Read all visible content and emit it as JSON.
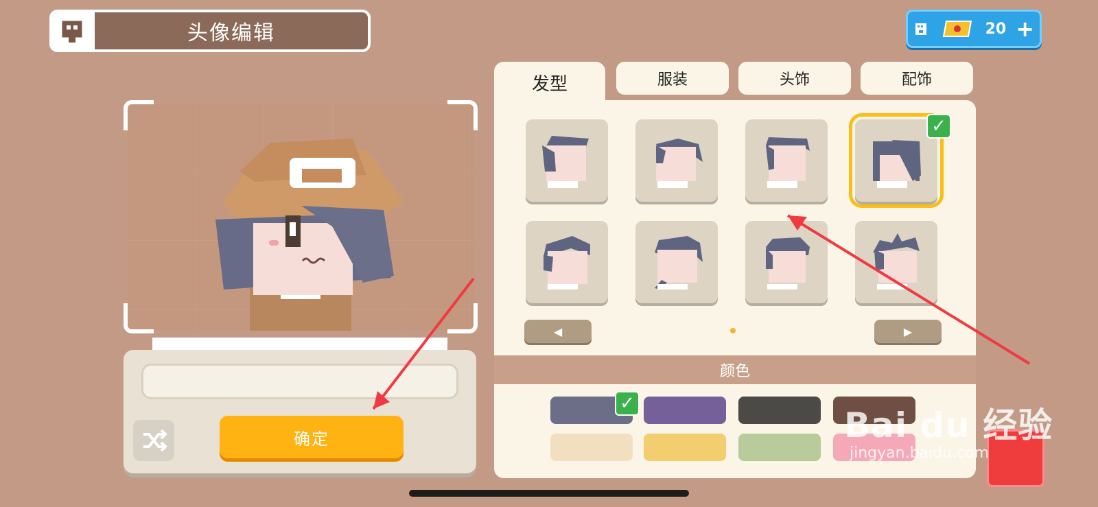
{
  "header": {
    "title": "头像编辑"
  },
  "currency": {
    "count": "20",
    "plus": "+"
  },
  "tabs": [
    {
      "label": "发型",
      "active": true
    },
    {
      "label": "服装",
      "active": false
    },
    {
      "label": "头饰",
      "active": false
    },
    {
      "label": "配饰",
      "active": false
    }
  ],
  "hair_grid": {
    "selected_index": 3,
    "items": [
      {
        "name": "hair-style-1"
      },
      {
        "name": "hair-style-2"
      },
      {
        "name": "hair-style-3"
      },
      {
        "name": "hair-style-4",
        "selected": true
      },
      {
        "name": "hair-style-5"
      },
      {
        "name": "hair-style-6"
      },
      {
        "name": "hair-style-7"
      },
      {
        "name": "hair-style-8"
      }
    ]
  },
  "nav": {
    "prev": "◀",
    "next": "▶"
  },
  "colors": {
    "label": "颜色",
    "swatches": [
      "#6c6d86",
      "#75609a",
      "#4b4a46",
      "#6f4e44",
      "#f1dfc0",
      "#f2ce6e",
      "#b8cb9b",
      "#f5a9b8"
    ],
    "selected_index": 0
  },
  "actions": {
    "confirm": "确定"
  },
  "watermark": {
    "main": "Bai du 经验",
    "sub": "jingyan.baidu.com"
  },
  "icons": [
    "avatar-frame-icon",
    "ticket-icon",
    "shuffle-icon",
    "check-icon",
    "exit-icon"
  ]
}
